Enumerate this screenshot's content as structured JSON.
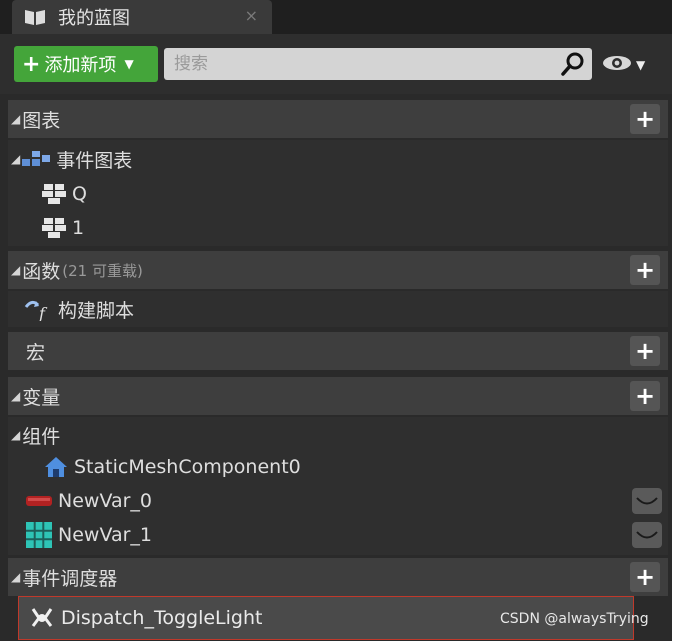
{
  "tab": {
    "title": "我的蓝图",
    "close": "×"
  },
  "toolbar": {
    "add_label": "添加新项",
    "search_placeholder": "搜索"
  },
  "sections": {
    "graphs": {
      "title": "图表",
      "event_graph": "事件图表",
      "items": [
        "Q",
        "1"
      ]
    },
    "functions": {
      "title": "函数",
      "note": "(21 可重载)",
      "items": [
        "构建脚本"
      ]
    },
    "macros": {
      "title": "宏"
    },
    "variables": {
      "title": "变量",
      "components_group": "组件",
      "component": "StaticMeshComponent0",
      "vars": [
        "NewVar_0",
        "NewVar_1"
      ]
    },
    "dispatchers": {
      "title": "事件调度器",
      "items": [
        "Dispatch_ToggleLight"
      ]
    }
  },
  "watermark": "CSDN @alwaysTrying",
  "colors": {
    "accent_green": "#44a53a",
    "selection_border": "#c0392b",
    "var_red": "#b22222",
    "var_teal": "#2ec4b6"
  }
}
